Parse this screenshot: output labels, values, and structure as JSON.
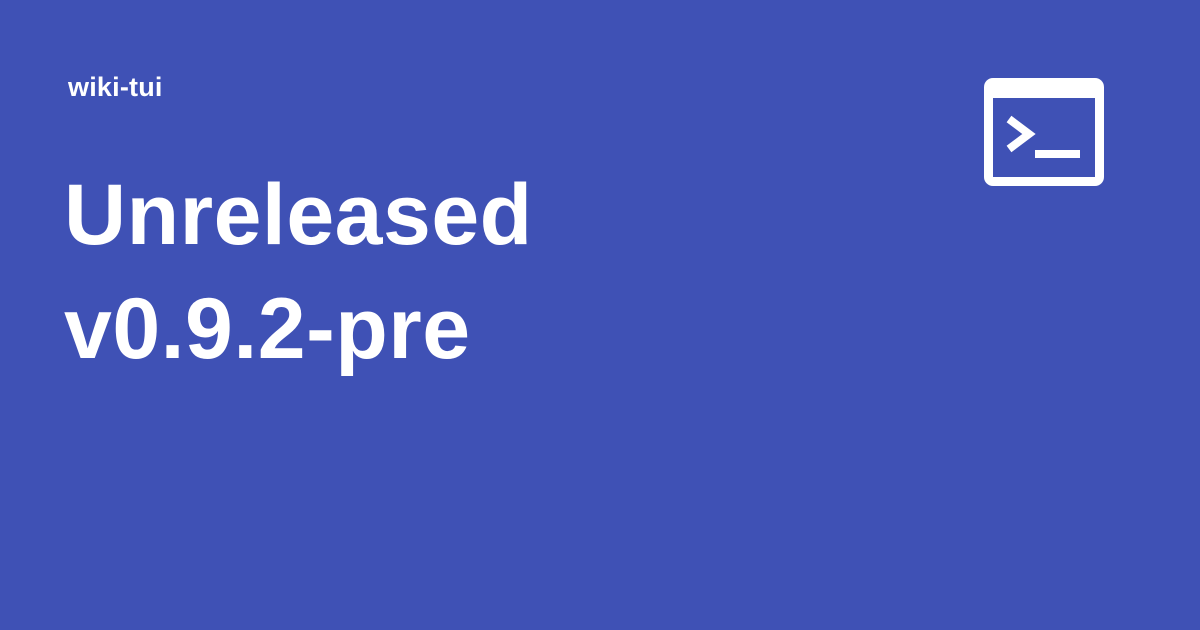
{
  "site": {
    "name": "wiki-tui"
  },
  "page": {
    "title_lines": [
      "Unreleased",
      "v0.9.2-pre"
    ]
  },
  "logo": {
    "icon": "terminal-icon"
  },
  "colors": {
    "background": "#3f51b5",
    "foreground": "#ffffff"
  }
}
